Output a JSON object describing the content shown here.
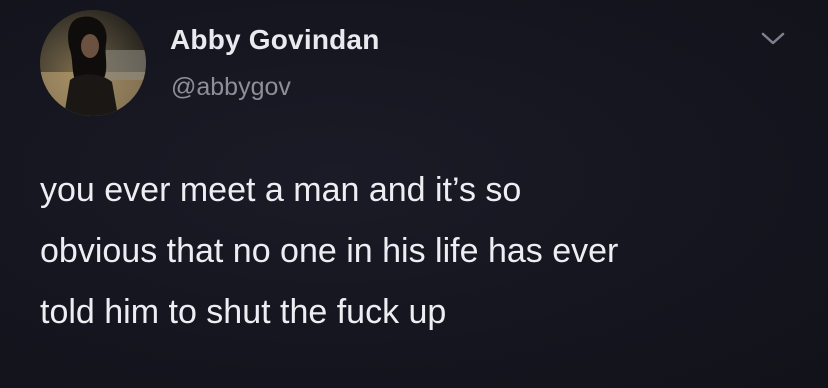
{
  "tweet": {
    "author": {
      "name": "Abby Govindan",
      "handle": "@abbygov"
    },
    "icons": {
      "menu": "chevron-down-icon",
      "avatar": "profile-photo"
    },
    "text_lines": [
      "you ever meet a man and it’s so",
      "obvious that no one in his life has ever",
      "told him to shut the fuck up"
    ]
  },
  "colors": {
    "background": "#15151f",
    "name": "#e9e9ee",
    "handle": "#8a8f99",
    "body_text": "#ededf2"
  }
}
